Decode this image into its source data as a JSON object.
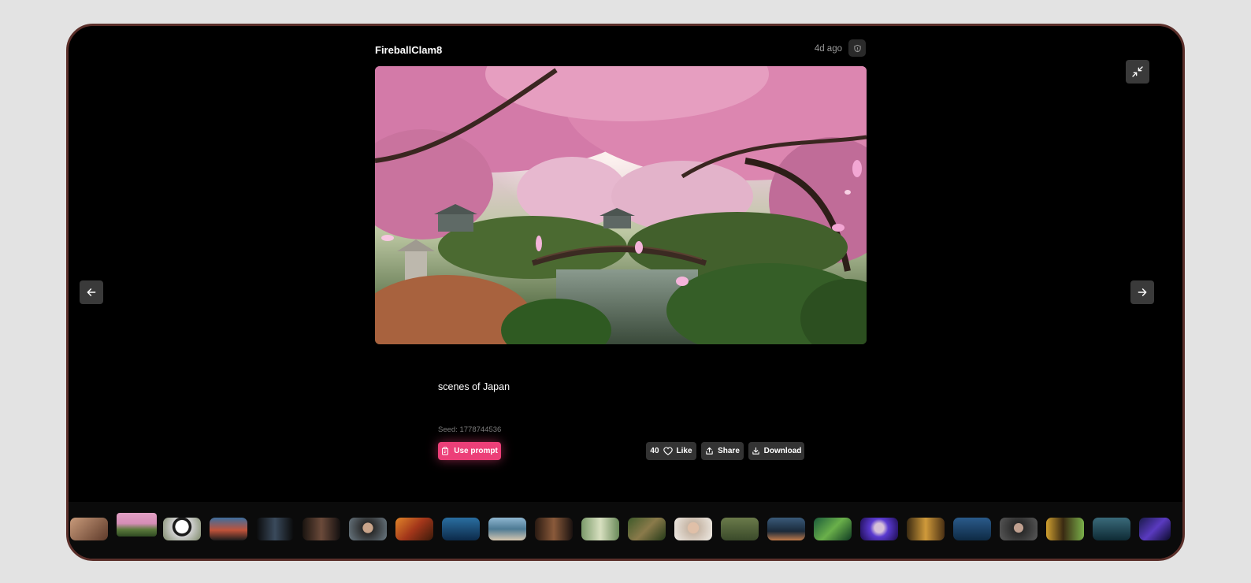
{
  "header": {
    "author": "FireballClam8",
    "time": "4d ago"
  },
  "icons": {
    "report": "shield-icon",
    "collapse": "minimize-icon",
    "prev": "arrow-left-icon",
    "next": "arrow-right-icon",
    "clipboard": "clipboard-icon",
    "heart": "heart-icon",
    "share": "share-icon",
    "download": "download-icon"
  },
  "post": {
    "prompt": "scenes of Japan",
    "seed": "Seed: 1778744536"
  },
  "actions": {
    "use_prompt": "Use prompt",
    "like_count": "40",
    "like": "Like",
    "share": "Share",
    "download": "Download"
  },
  "colors": {
    "accent": "#ec3f78",
    "background": "#000000",
    "button": "#333333"
  }
}
